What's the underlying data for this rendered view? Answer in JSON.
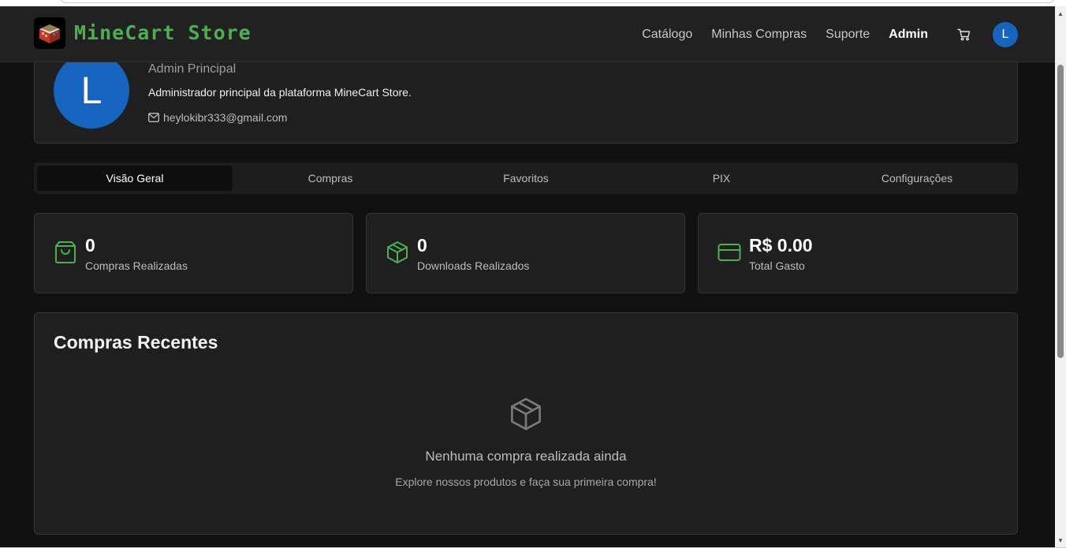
{
  "navbar": {
    "brand": "MineCart Store",
    "links": [
      "Catálogo",
      "Minhas Compras",
      "Suporte",
      "Admin"
    ],
    "active_link": "Admin",
    "avatar_initial": "L"
  },
  "profile": {
    "avatar_initial": "L",
    "role": "Admin Principal",
    "description": "Administrador principal da plataforma MineCart Store.",
    "email": "heylokibr333@gmail.com"
  },
  "tabs": [
    "Visão Geral",
    "Compras",
    "Favoritos",
    "PIX",
    "Configurações"
  ],
  "active_tab": "Visão Geral",
  "stats": [
    {
      "value": "0",
      "label": "Compras Realizadas",
      "icon": "shopping-bag-icon"
    },
    {
      "value": "0",
      "label": "Downloads Realizados",
      "icon": "package-icon"
    },
    {
      "value": "R$ 0.00",
      "label": "Total Gasto",
      "icon": "credit-card-icon"
    }
  ],
  "recent": {
    "title": "Compras Recentes",
    "empty_title": "Nenhuma compra realizada ainda",
    "empty_subtitle": "Explore nossos produtos e faça sua primeira compra!",
    "empty_icon": "package-icon"
  },
  "colors": {
    "accent": "#4caf50",
    "avatar": "#1565c0",
    "background": "#111111",
    "card": "#1f1f1f"
  }
}
